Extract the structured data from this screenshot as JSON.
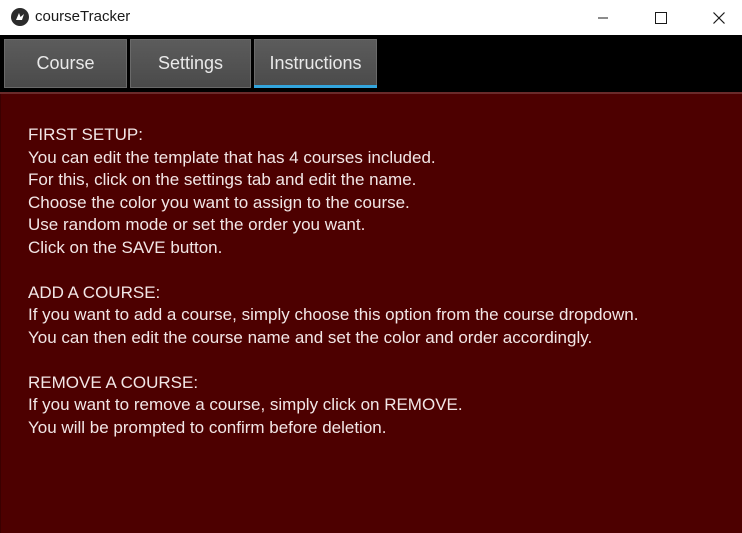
{
  "window": {
    "title": "courseTracker",
    "icon": "kivy-logo-icon",
    "controls": [
      "minimize-icon",
      "maximize-icon",
      "close-icon"
    ]
  },
  "tabs": [
    {
      "label": "Course",
      "active": false
    },
    {
      "label": "Settings",
      "active": false
    },
    {
      "label": "Instructions",
      "active": true
    }
  ],
  "colors": {
    "panel_background": "#4d0000",
    "tab_background": "#535353",
    "active_tab_underline": "#33a5dd",
    "text": "#f2e6e6"
  },
  "instructions": {
    "lines": [
      "FIRST SETUP:",
      "You can edit the template that has 4 courses included.",
      "For this, click on the settings tab and edit the name.",
      "Choose the color you want to assign to the course.",
      "Use random mode or set the order you want.",
      "Click on the SAVE button.",
      "",
      "ADD A COURSE:",
      "If you want to add a course, simply choose this option from the course dropdown.",
      "You can then edit the course name and set the color and order accordingly.",
      "",
      "REMOVE A COURSE:",
      "If you want to remove a course, simply click on REMOVE.",
      "You will be prompted to confirm before deletion."
    ]
  }
}
